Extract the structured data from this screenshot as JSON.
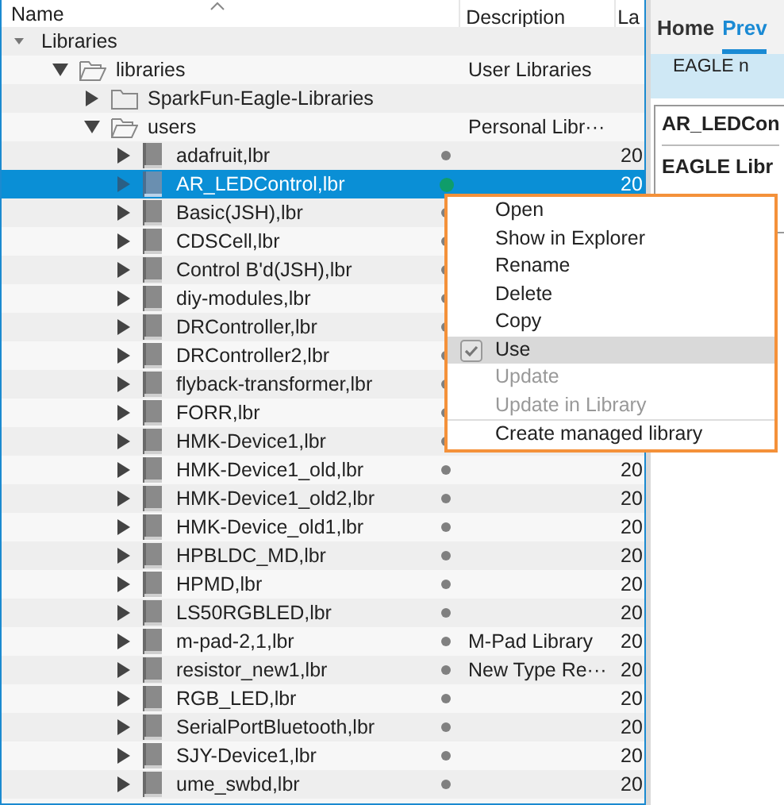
{
  "columns": [
    {
      "label": "Name",
      "sorted": true
    },
    {
      "label": "Description"
    },
    {
      "label": "La"
    }
  ],
  "tree": [
    {
      "name": "Libraries",
      "kind": "root",
      "expanded": true,
      "children": [
        {
          "name": "libraries",
          "kind": "folder",
          "expanded": true,
          "description": "User Libraries",
          "children": [
            {
              "name": "SparkFun-Eagle-Libraries",
              "kind": "folder",
              "expanded": false
            },
            {
              "name": "users",
              "kind": "folder",
              "expanded": true,
              "description": "Personal Libr···",
              "children": [
                {
                  "name": "adafruit,lbr",
                  "kind": "library",
                  "expanded": false,
                  "selected": false,
                  "color": "#808080",
                  "date": "20"
                },
                {
                  "name": "AR_LEDControl,lbr",
                  "kind": "library",
                  "expanded": false,
                  "selected": true,
                  "color": "#0f9d6a",
                  "date": "20"
                },
                {
                  "name": "Basic(JSH),lbr",
                  "kind": "library",
                  "expanded": false,
                  "selected": false,
                  "color": "#808080"
                },
                {
                  "name": "CDSCell,lbr",
                  "kind": "library",
                  "expanded": false,
                  "selected": false,
                  "color": "#808080"
                },
                {
                  "name": "Control B'd(JSH),lbr",
                  "kind": "library",
                  "expanded": false,
                  "selected": false,
                  "color": "#808080"
                },
                {
                  "name": "diy-modules,lbr",
                  "kind": "library",
                  "expanded": false,
                  "selected": false,
                  "color": "#808080"
                },
                {
                  "name": "DRController,lbr",
                  "kind": "library",
                  "expanded": false,
                  "selected": false,
                  "color": "#808080"
                },
                {
                  "name": "DRController2,lbr",
                  "kind": "library",
                  "expanded": false,
                  "selected": false,
                  "color": "#808080"
                },
                {
                  "name": "flyback-transformer,lbr",
                  "kind": "library",
                  "expanded": false,
                  "selected": false,
                  "color": "#808080"
                },
                {
                  "name": "FORR,lbr",
                  "kind": "library",
                  "expanded": false,
                  "selected": false,
                  "color": "#808080"
                },
                {
                  "name": "HMK-Device1,lbr",
                  "kind": "library",
                  "expanded": false,
                  "selected": false,
                  "color": "#808080"
                },
                {
                  "name": "HMK-Device1_old,lbr",
                  "kind": "library",
                  "expanded": false,
                  "selected": false,
                  "color": "#808080",
                  "date": "20"
                },
                {
                  "name": "HMK-Device1_old2,lbr",
                  "kind": "library",
                  "expanded": false,
                  "selected": false,
                  "color": "#808080",
                  "date": "20"
                },
                {
                  "name": "HMK-Device_old1,lbr",
                  "kind": "library",
                  "expanded": false,
                  "selected": false,
                  "color": "#808080",
                  "date": "20"
                },
                {
                  "name": "HPBLDC_MD,lbr",
                  "kind": "library",
                  "expanded": false,
                  "selected": false,
                  "color": "#808080",
                  "date": "20"
                },
                {
                  "name": "HPMD,lbr",
                  "kind": "library",
                  "expanded": false,
                  "selected": false,
                  "color": "#808080",
                  "date": "20"
                },
                {
                  "name": "LS50RGBLED,lbr",
                  "kind": "library",
                  "expanded": false,
                  "selected": false,
                  "color": "#808080",
                  "date": "20"
                },
                {
                  "name": "m-pad-2,1,lbr",
                  "kind": "library",
                  "expanded": false,
                  "selected": false,
                  "color": "#808080",
                  "description": "M-Pad Library",
                  "date": "20"
                },
                {
                  "name": "resistor_new1,lbr",
                  "kind": "library",
                  "expanded": false,
                  "selected": false,
                  "color": "#808080",
                  "description": "New Type Re···",
                  "date": "20"
                },
                {
                  "name": "RGB_LED,lbr",
                  "kind": "library",
                  "expanded": false,
                  "selected": false,
                  "color": "#808080",
                  "date": "20"
                },
                {
                  "name": "SerialPortBluetooth,lbr",
                  "kind": "library",
                  "expanded": false,
                  "selected": false,
                  "color": "#808080",
                  "date": "20"
                },
                {
                  "name": "SJY-Device1,lbr",
                  "kind": "library",
                  "expanded": false,
                  "selected": false,
                  "color": "#808080",
                  "date": "20"
                },
                {
                  "name": "ume_swbd,lbr",
                  "kind": "library",
                  "expanded": false,
                  "selected": false,
                  "color": "#808080",
                  "date": "20"
                }
              ]
            }
          ]
        }
      ]
    }
  ],
  "preview": {
    "tabs": [
      {
        "label": "Home",
        "selected": false
      },
      {
        "label": "Prev",
        "selected": true
      }
    ],
    "banner": "EAGLE n",
    "title": "AR_LEDCon",
    "subtitle": "EAGLE Libr"
  },
  "context_menu": [
    {
      "label": "Open",
      "disabled": false,
      "checked": false,
      "highlighted": false
    },
    {
      "label": "Show in Explorer",
      "disabled": false,
      "checked": false,
      "highlighted": false
    },
    {
      "label": "Rename",
      "disabled": false,
      "checked": false,
      "highlighted": false
    },
    {
      "label": "Delete",
      "disabled": false,
      "checked": false,
      "highlighted": false
    },
    {
      "label": "Copy",
      "disabled": false,
      "checked": false,
      "highlighted": false
    },
    {
      "label": "Use",
      "disabled": false,
      "checked": true,
      "highlighted": true
    },
    {
      "label": "Update",
      "disabled": true,
      "checked": false,
      "highlighted": false
    },
    {
      "label": "Update in Library",
      "disabled": true,
      "checked": false,
      "highlighted": false,
      "separator_after": true
    },
    {
      "label": "Create managed library",
      "disabled": false,
      "checked": false,
      "highlighted": false
    }
  ]
}
